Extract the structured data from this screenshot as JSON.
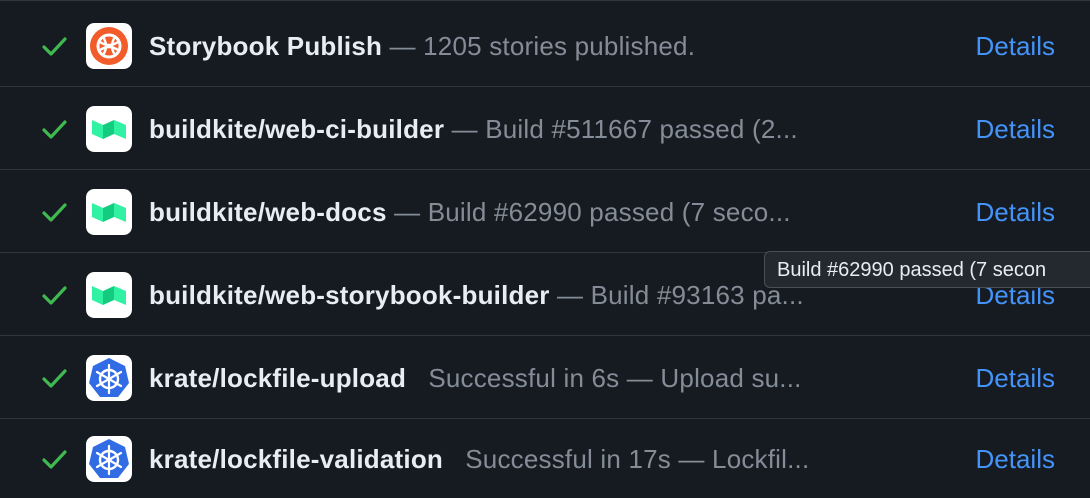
{
  "checks": [
    {
      "name": "Storybook Publish",
      "description": " — 1205 stories published.",
      "details_label": "Details",
      "status": "success",
      "icon": "storybook-icon"
    },
    {
      "name": "buildkite/web-ci-builder",
      "description": " — Build #511667 passed (2...",
      "details_label": "Details",
      "status": "success",
      "icon": "buildkite-icon"
    },
    {
      "name": "buildkite/web-docs",
      "description": " — Build #62990 passed (7 seco...",
      "details_label": "Details",
      "status": "success",
      "icon": "buildkite-icon"
    },
    {
      "name": "buildkite/web-storybook-builder",
      "description": " — Build #93163 pa...",
      "details_label": "Details",
      "status": "success",
      "icon": "buildkite-icon"
    },
    {
      "name": "krate/lockfile-upload",
      "description": "   Successful in 6s — Upload su...",
      "details_label": "Details",
      "status": "success",
      "icon": "kubernetes-icon"
    },
    {
      "name": "krate/lockfile-validation",
      "description": "   Successful in 17s — Lockfil...",
      "details_label": "Details",
      "status": "success",
      "icon": "kubernetes-icon"
    }
  ],
  "tooltip": {
    "text": "Build #62990 passed (7 secon"
  },
  "colors": {
    "background": "#161b22",
    "success": "#3fb950",
    "link": "#4493f8",
    "storybook": "#ff4785",
    "buildkite": "#14cc80",
    "kubernetes": "#326ce5"
  }
}
